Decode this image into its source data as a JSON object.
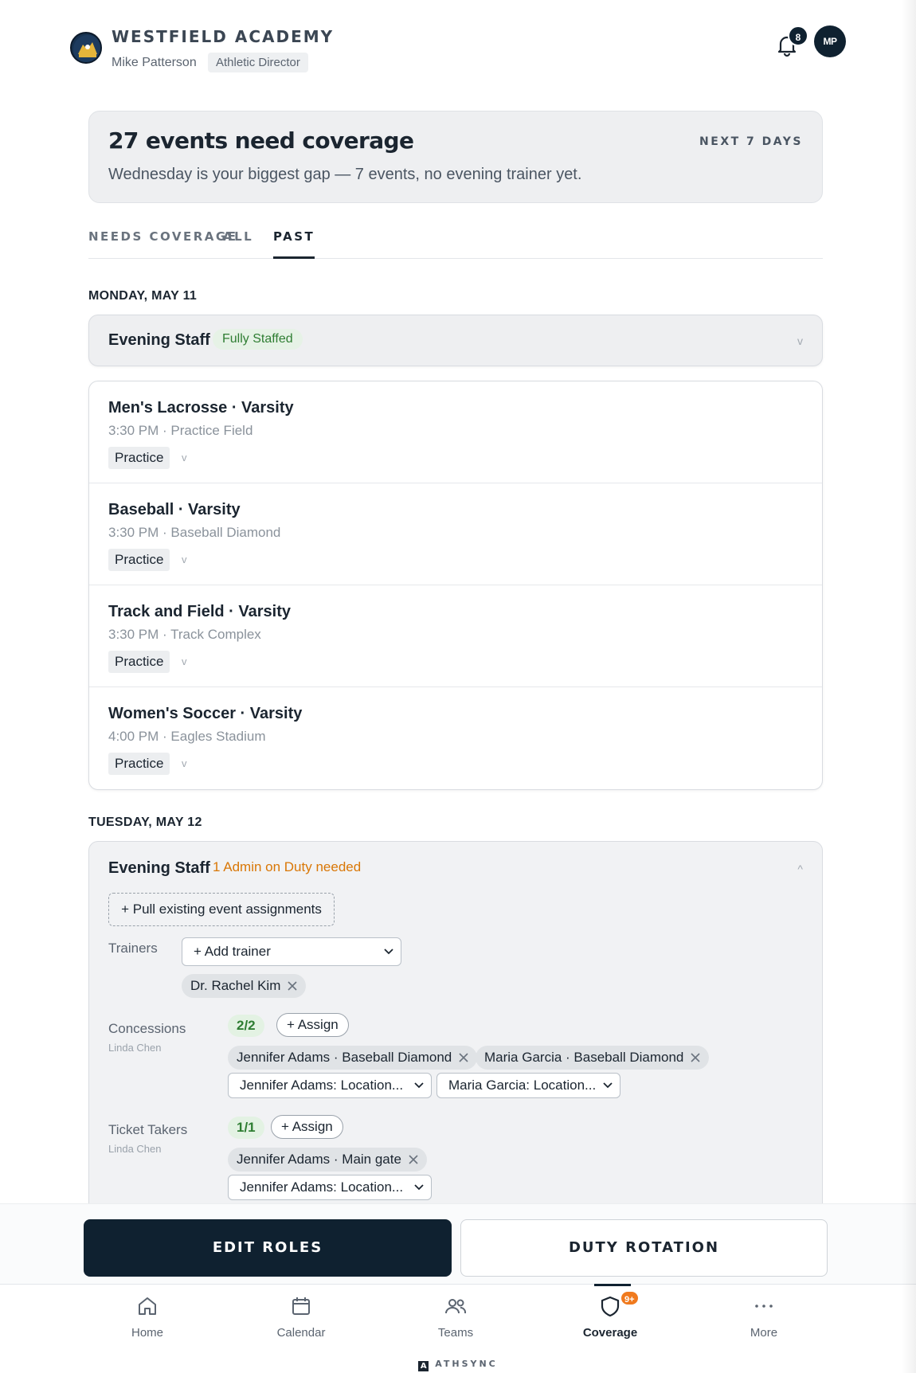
{
  "header": {
    "org_name": "WESTFIELD ACADEMY",
    "user_name": "Mike Patterson",
    "user_role": "Athletic Director",
    "notification_count": "8",
    "avatar_initials": "MP",
    "icons": [
      "team-logo",
      "bell-icon"
    ]
  },
  "summary": {
    "title": "27 events need coverage",
    "range": "NEXT 7 DAYS",
    "message": "Wednesday is your biggest gap — 7 events, no evening trainer yet."
  },
  "tabs": [
    {
      "label": "NEEDS COVERAGE",
      "active": false
    },
    {
      "label": "ALL",
      "active": false
    },
    {
      "label": "PAST",
      "active": true
    }
  ],
  "days": [
    {
      "label": "MONDAY, MAY 11",
      "staff": {
        "title": "Evening Staff",
        "status": "Fully Staffed",
        "status_color": "#2e7d32",
        "expanded": false
      },
      "events": [
        {
          "title": "Men's Lacrosse · Varsity",
          "time": "3:30 PM",
          "location": "Practice Field",
          "type": "Practice"
        },
        {
          "title": "Baseball · Varsity",
          "time": "3:30 PM",
          "location": "Baseball Diamond",
          "type": "Practice"
        },
        {
          "title": "Track and Field · Varsity",
          "time": "3:30 PM",
          "location": "Track Complex",
          "type": "Practice"
        },
        {
          "title": "Women's Soccer · Varsity",
          "time": "4:00 PM",
          "location": "Eagles Stadium",
          "type": "Practice"
        }
      ]
    },
    {
      "label": "TUESDAY, MAY 12",
      "staff": {
        "title": "Evening Staff",
        "status": "1 Admin on Duty needed",
        "status_color": "#d97706",
        "expanded": true,
        "pull_label": "+ Pull existing event assignments",
        "trainers": {
          "label": "Trainers",
          "select_value": "+ Add trainer",
          "assigned": [
            "Dr. Rachel Kim"
          ]
        },
        "concessions": {
          "label": "Concessions",
          "lead": "Linda Chen",
          "count": "2/2",
          "assign_label": "+ Assign",
          "assigned": [
            "Jennifer Adams · Baseball Diamond",
            "Maria Garcia · Baseball Diamond"
          ],
          "location_selects": [
            "Jennifer Adams: Location...",
            "Maria Garcia: Location..."
          ]
        },
        "ticket_takers": {
          "label": "Ticket Takers",
          "lead": "Linda Chen",
          "count": "1/1",
          "assign_label": "+ Assign",
          "assigned": [
            "Jennifer Adams · Main gate"
          ],
          "location_selects": [
            "Jennifer Adams: Location..."
          ]
        }
      }
    }
  ],
  "actions": {
    "primary": "EDIT ROLES",
    "secondary": "DUTY ROTATION"
  },
  "nav": {
    "items": [
      {
        "label": "Home",
        "icon": "home-icon"
      },
      {
        "label": "Calendar",
        "icon": "calendar-icon"
      },
      {
        "label": "Teams",
        "icon": "users-icon"
      },
      {
        "label": "Coverage",
        "icon": "shield-icon",
        "badge": "9+",
        "active": true
      },
      {
        "label": "More",
        "icon": "more-icon"
      }
    ],
    "brand": "ATHSYNC",
    "brand_mark": "A"
  },
  "colors": {
    "primary": "#0f2130",
    "success": "#2e7d32",
    "warning": "#d97706",
    "badge": "#f07a1e"
  }
}
